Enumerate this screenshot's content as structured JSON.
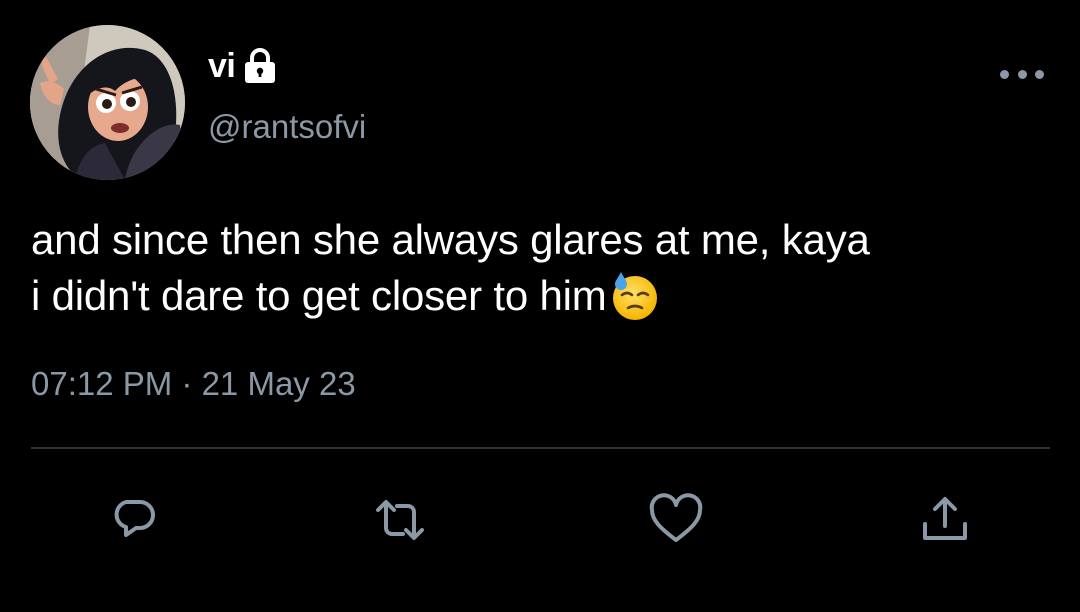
{
  "tweet": {
    "author": {
      "display_name": "vi",
      "handle": "@rantsofvi",
      "protected_icon": "lock-icon",
      "avatar": "cartoon-avatar"
    },
    "menu_icon": "more-horizontal-icon",
    "text_lines": [
      "and since then she always glares at me, kaya",
      "i didn't dare to get closer to him"
    ],
    "emoji": "downcast-face-with-sweat-emoji",
    "timestamp": "07:12 PM · 21 May 23",
    "actions": [
      {
        "name": "reply",
        "icon": "reply-icon"
      },
      {
        "name": "retweet",
        "icon": "retweet-icon"
      },
      {
        "name": "like",
        "icon": "heart-icon"
      },
      {
        "name": "share",
        "icon": "share-icon"
      }
    ],
    "colors": {
      "background": "#000000",
      "text": "#ffffff",
      "secondary_text": "#8b98a5",
      "divider": "#2f3336"
    }
  }
}
